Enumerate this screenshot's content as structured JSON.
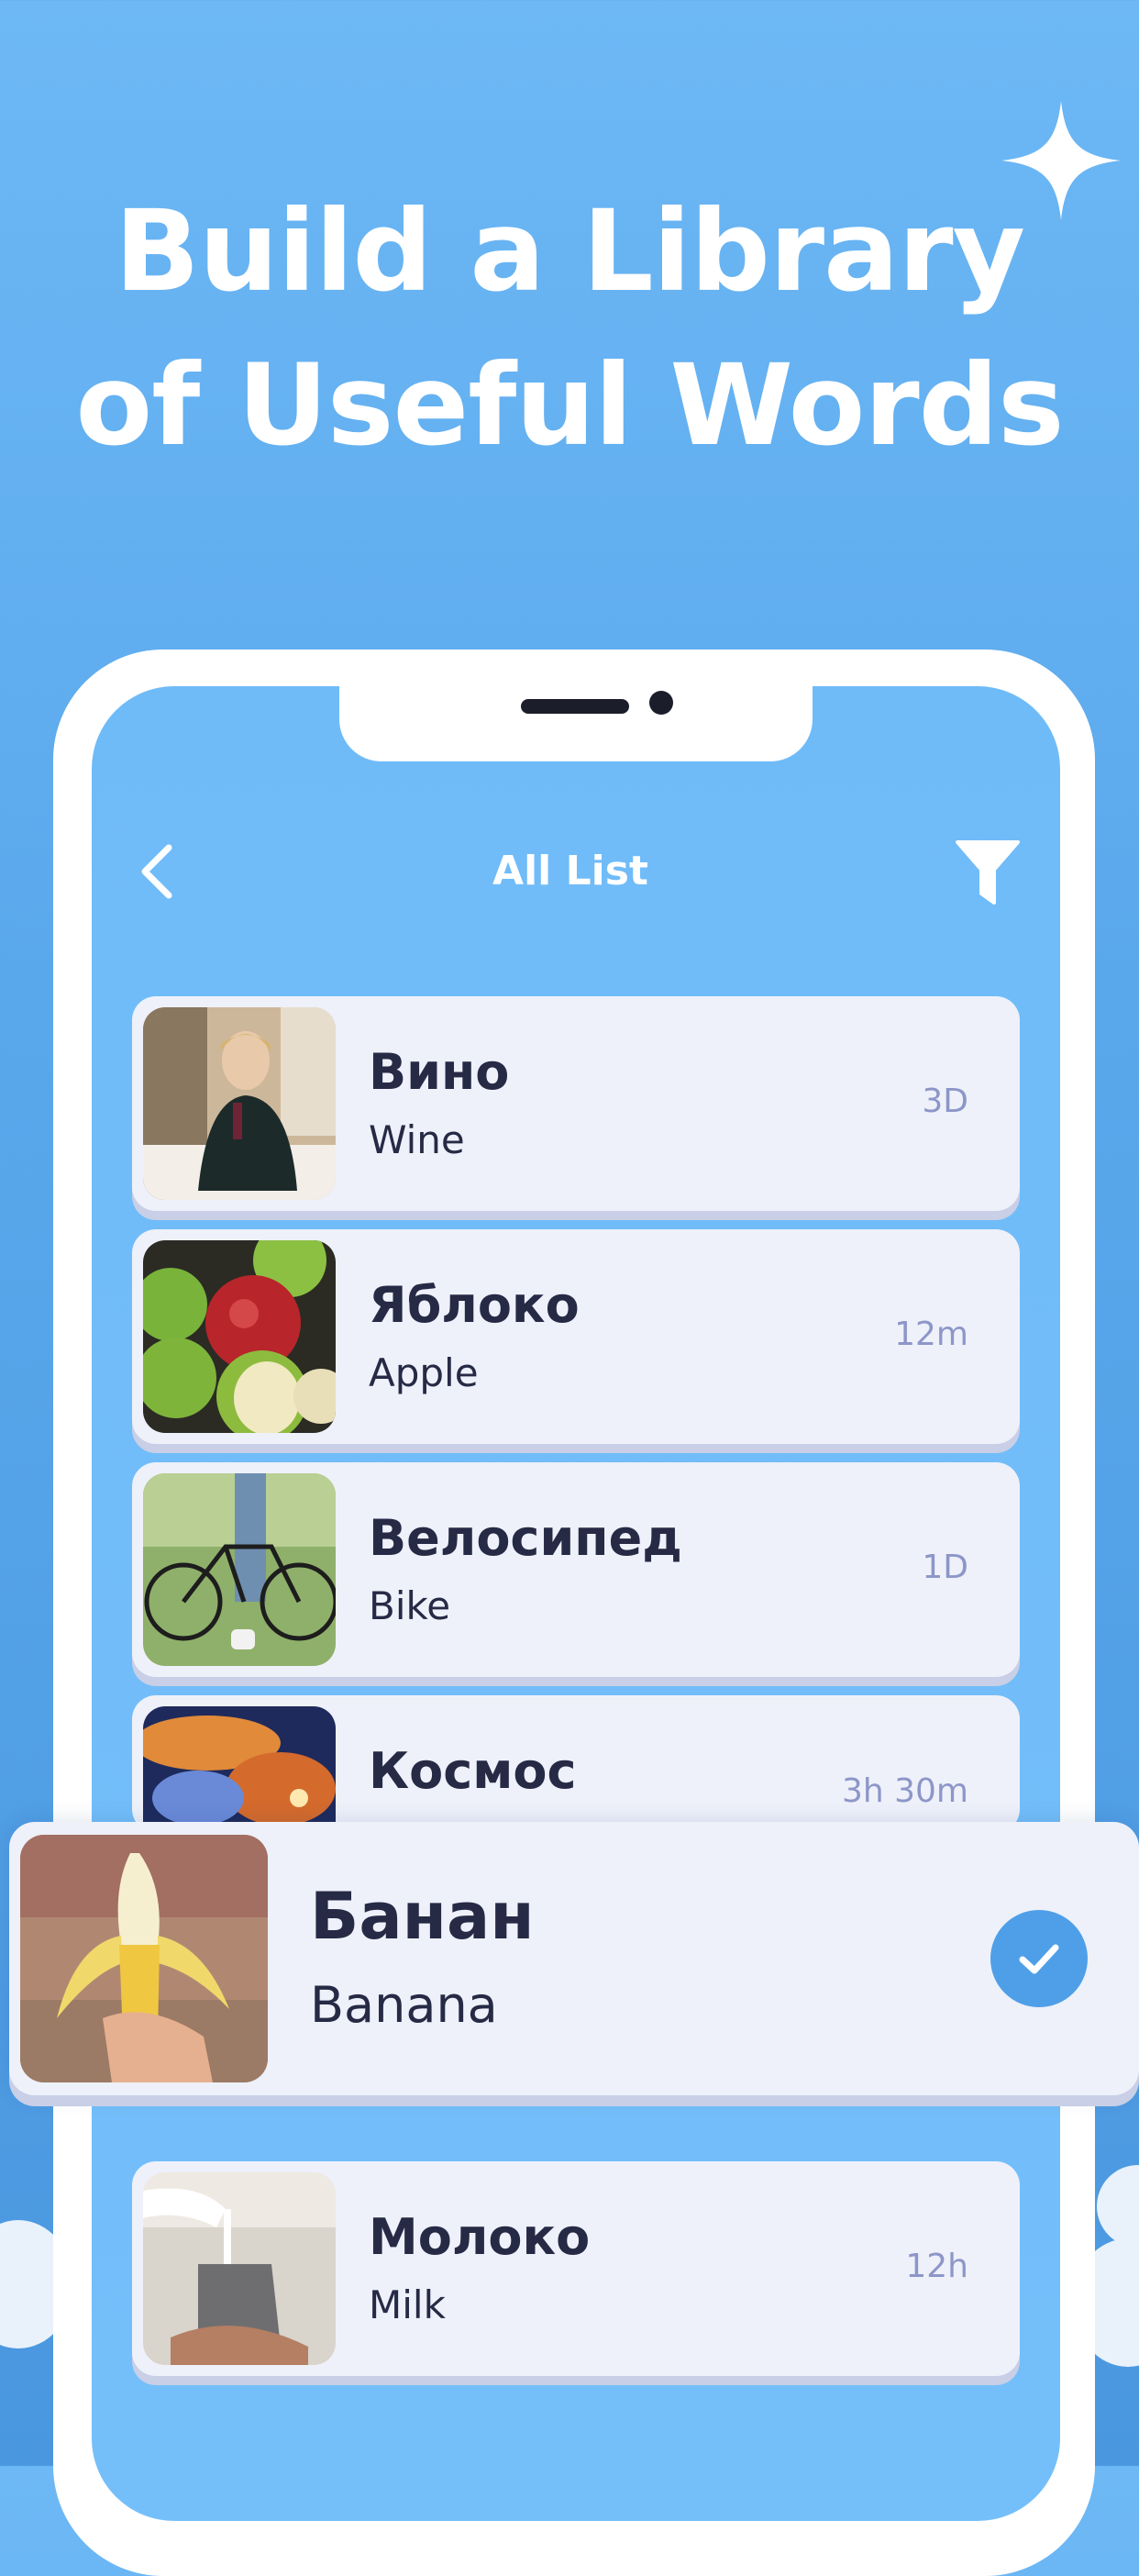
{
  "headline": {
    "line1": "Build a Library",
    "line2": "of Useful Words"
  },
  "screen": {
    "title": "All List",
    "back_icon": "chevron-left-icon",
    "filter_icon": "filter-icon"
  },
  "words": [
    {
      "ru": "Вино",
      "en": "Wine",
      "time": "3D",
      "image": "woman-drinking-wine"
    },
    {
      "ru": "Яблоко",
      "en": "Apple",
      "time": "12m",
      "image": "apples"
    },
    {
      "ru": "Велосипед",
      "en": "Bike",
      "time": "1D",
      "image": "bicycle"
    },
    {
      "ru": "Космос",
      "en": "",
      "time": "3h 30m",
      "image": "space-nebula"
    },
    {
      "ru": "Молоко",
      "en": "Milk",
      "time": "12h",
      "image": "milk-pouring"
    }
  ],
  "focused": {
    "ru": "Банан",
    "en": "Banana",
    "image": "banana",
    "status_icon": "checkmark-icon"
  },
  "colors": {
    "background": "#5aa8ec",
    "screen": "#74bffa",
    "card": "#eef1fa",
    "text": "#262a45",
    "time": "#8d96c8",
    "accent": "#4f9fe8"
  }
}
